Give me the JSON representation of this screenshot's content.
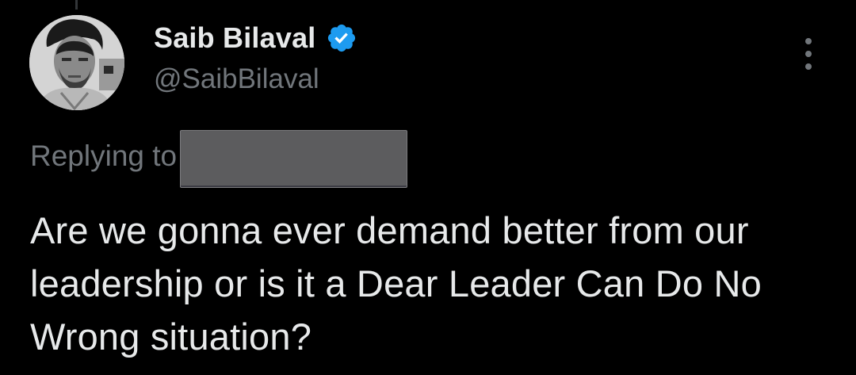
{
  "tweet": {
    "author": {
      "display_name": "Saib Bilaval",
      "handle": "@SaibBilaval",
      "verified": true,
      "verified_icon": "verified-badge-icon",
      "avatar": "profile-photo"
    },
    "reply_context": {
      "label": "Replying to",
      "recipient_redacted": true
    },
    "text": "Are we gonna ever demand better from our leadership or is it a Dear Leader Can Do No Wrong situation?",
    "more_icon": "more-vertical-icon"
  },
  "colors": {
    "background": "#000000",
    "primary_text": "#e7e9ea",
    "secondary_text": "#71767b",
    "verified_blue": "#1d9bf0",
    "redaction": "#5c5c5e"
  }
}
